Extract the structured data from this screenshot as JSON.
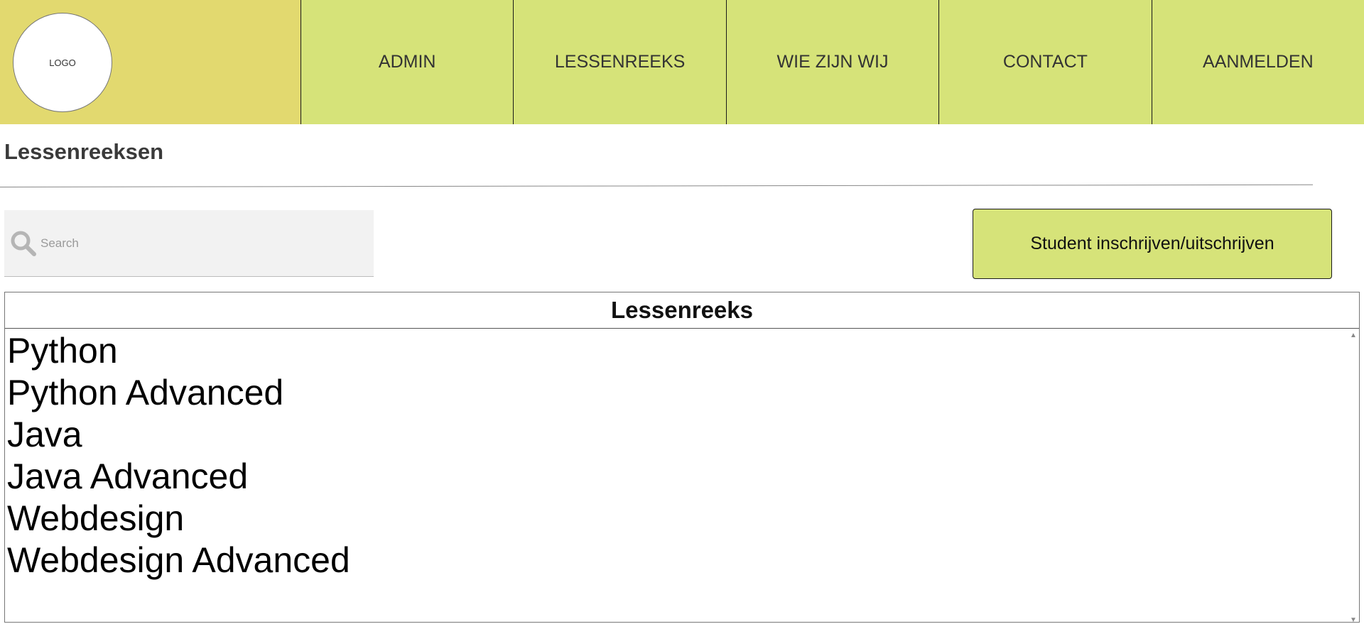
{
  "header": {
    "logo_text": "LOGO",
    "nav": [
      {
        "label": "ADMIN"
      },
      {
        "label": "LESSENREEKS"
      },
      {
        "label": "WIE ZIJN WIJ"
      },
      {
        "label": "CONTACT"
      },
      {
        "label": "AANMELDEN"
      }
    ]
  },
  "main": {
    "title": "Lessenreeksen",
    "search": {
      "placeholder": "Search",
      "value": ""
    },
    "enroll_button_label": "Student inschrijven/uitschrijven",
    "table": {
      "header": "Lessenreeks",
      "rows": [
        "Python",
        "Python Advanced",
        "Java",
        "Java Advanced",
        "Webdesign",
        "Webdesign Advanced"
      ]
    }
  },
  "colors": {
    "logo_bg": "#e2d96f",
    "nav_bg": "#d6e379",
    "button_bg": "#d6e379"
  },
  "icons": {
    "search": "search-icon",
    "scroll_up": "scroll-up-arrow-icon",
    "scroll_down": "scroll-down-arrow-icon"
  }
}
